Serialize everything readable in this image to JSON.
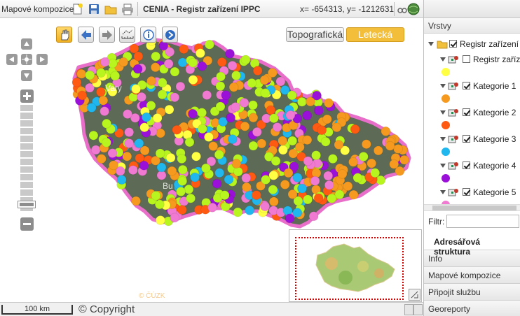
{
  "topbar": {
    "compositions_label": "Mapové kompozice:",
    "title": "CENIA - Registr zařízení IPPC",
    "coordinates": "x= -654313, y= -1212631",
    "icons": [
      "new-document-icon",
      "save-icon",
      "open-folder-icon",
      "print-icon",
      "globe-icon",
      "binoculars-icon"
    ]
  },
  "map": {
    "tools": [
      "pan-hand-icon",
      "back-arrow-icon",
      "forward-arrow-icon",
      "measure-icon",
      "info-icon",
      "coordinate-icon"
    ],
    "base_layers": [
      {
        "label": "Topografická",
        "active": false
      },
      {
        "label": "Letecká",
        "active": true
      }
    ],
    "watermark": "© ČÚZK"
  },
  "status": {
    "scale_label": "100 km",
    "copyright": "Copyright",
    "copyright_symbol": "©"
  },
  "panel": {
    "header": "Vrstvy",
    "tree": {
      "root": "Registr zařízení IPPC",
      "items": [
        {
          "label": "Registr zaříze",
          "checked": false,
          "color": "#ffff44"
        },
        {
          "label": "Kategorie 1",
          "checked": true,
          "color": "#f59a1e"
        },
        {
          "label": "Kategorie 2",
          "checked": true,
          "color": "#ff5a12"
        },
        {
          "label": "Kategorie 3",
          "checked": true,
          "color": "#1fb7ee"
        },
        {
          "label": "Kategorie 4",
          "checked": true,
          "color": "#9a10d8"
        },
        {
          "label": "Kategorie 5",
          "checked": true,
          "color": "#f07ad2"
        }
      ]
    },
    "filter_label": "Filtr:",
    "filter_value": "",
    "tabs": [
      {
        "label": "Adresářová struktura",
        "active": true
      },
      {
        "label": "Info",
        "active": false
      },
      {
        "label": "Mapové kompozice",
        "active": false
      },
      {
        "label": "Připojit službu",
        "active": false
      },
      {
        "label": "Georeporty",
        "active": false
      }
    ]
  },
  "dot_colors": [
    "#b8f51f",
    "#b8f51f",
    "#b8f51f",
    "#f59a1e",
    "#f59a1e",
    "#ff5a12",
    "#1fb7ee",
    "#9a10d8",
    "#f07ad2",
    "#f07ad2",
    "#ffff44"
  ]
}
